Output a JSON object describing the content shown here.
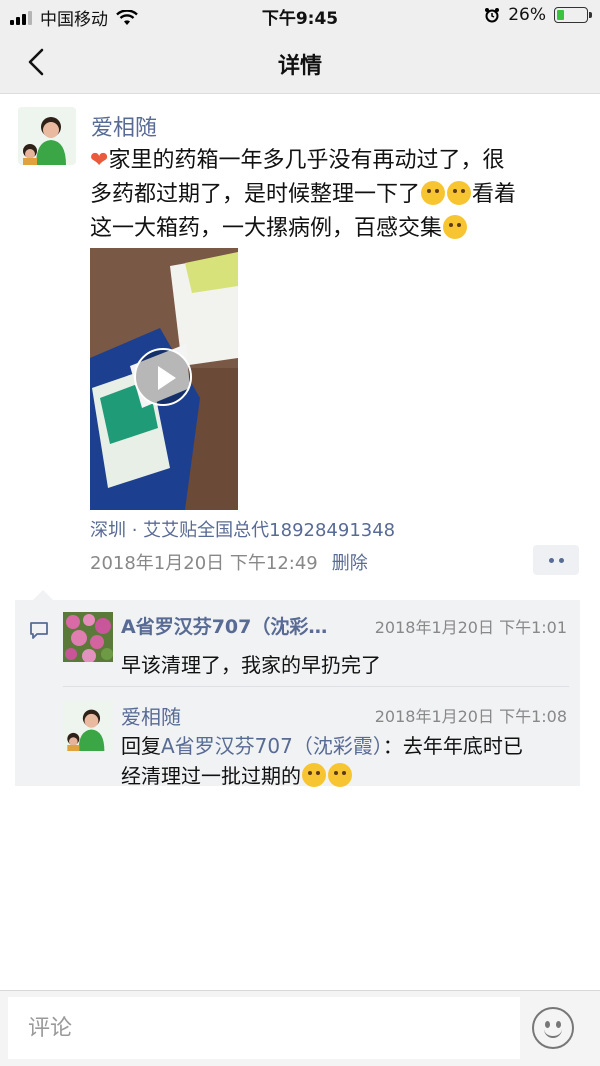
{
  "status_bar": {
    "carrier": "中国移动",
    "time": "下午9:45",
    "battery_percent": "26%",
    "battery_level": 0.26,
    "icons": [
      "signal-icon",
      "wifi-icon",
      "alarm-icon",
      "battery-icon"
    ]
  },
  "nav": {
    "title": "详情",
    "back_icon": "chevron-left-icon"
  },
  "post": {
    "author": "爱相随",
    "text_line1": "家里的药箱一年多几乎没有再动过了，很",
    "text_line2a": "多药都过期了，是时候整理一下了",
    "text_line2b": "看着",
    "text_line3": "这一大箱药，一大摞病例，百感交集",
    "location": "深圳 · 艾艾贴全国总代18928491348",
    "timestamp": "2018年1月20日 下午12:49",
    "delete_label": "删除",
    "media_type": "video"
  },
  "comments": [
    {
      "author": "A省罗汉芬707（沈彩…",
      "time": "2018年1月20日 下午1:01",
      "text": "早该清理了，我家的早扔完了"
    },
    {
      "author": "爱相随",
      "time": "2018年1月20日 下午1:08",
      "reply_prefix": "回复",
      "reply_target": "A省罗汉芬707（沈彩霞）",
      "text_after": "：去年年底时已",
      "text_line2": "经清理过一批过期的"
    }
  ],
  "input": {
    "placeholder": "评论"
  },
  "colors": {
    "link_blue": "#586b95",
    "bar_bg": "#efefef",
    "comment_bg": "#f1f2f4"
  }
}
